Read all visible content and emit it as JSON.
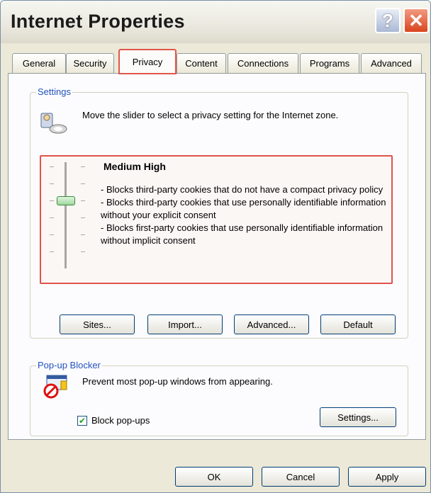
{
  "window": {
    "title": "Internet Properties",
    "help_label": "?",
    "close_label": "✕"
  },
  "tabs": [
    {
      "label": "General"
    },
    {
      "label": "Security"
    },
    {
      "label": "Privacy"
    },
    {
      "label": "Content"
    },
    {
      "label": "Connections"
    },
    {
      "label": "Programs"
    },
    {
      "label": "Advanced"
    }
  ],
  "active_tab": "Privacy",
  "settings": {
    "group_label": "Settings",
    "description": "Move the slider to select a privacy setting for the Internet zone.",
    "level_title": "Medium High",
    "level_lines": [
      "- Blocks third-party cookies that do not have a compact privacy policy",
      "- Blocks third-party cookies that use personally identifiable information without your explicit consent",
      "- Blocks first-party cookies that use personally identifiable information without implicit consent"
    ],
    "slider_level": "Medium High",
    "buttons": {
      "sites": "Sites...",
      "import": "Import...",
      "advanced": "Advanced...",
      "default": "Default"
    }
  },
  "popup_blocker": {
    "group_label": "Pop-up Blocker",
    "description": "Prevent most pop-up windows from appearing.",
    "checkbox_label": "Block pop-ups",
    "checkbox_checked": true,
    "settings_button": "Settings..."
  },
  "footer": {
    "ok": "OK",
    "cancel": "Cancel",
    "apply": "Apply"
  },
  "colors": {
    "accent": "#2352bd",
    "highlight": "#e0524c",
    "window_bg": "#ece9d8"
  },
  "icons": {
    "privacy": "cookie-privacy-icon",
    "popup": "popup-blocked-icon"
  }
}
